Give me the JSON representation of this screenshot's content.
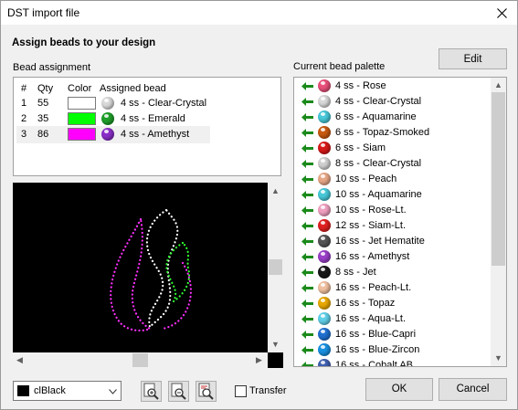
{
  "window": {
    "title": "DST import file"
  },
  "heading": "Assign beads to your design",
  "assignment": {
    "label": "Bead assignment",
    "headers": {
      "num": "#",
      "qty": "Qty",
      "color": "Color",
      "bead": "Assigned bead"
    },
    "rows": [
      {
        "num": "1",
        "qty": "55",
        "swatch": "#ffffff",
        "bead_color": "#d9d9d9",
        "bead": "4 ss - Clear-Crystal"
      },
      {
        "num": "2",
        "qty": "35",
        "swatch": "#00ff00",
        "bead_color": "#1e9e2a",
        "bead": "4 ss - Emerald"
      },
      {
        "num": "3",
        "qty": "86",
        "swatch": "#ff00ff",
        "bead_color": "#8b2fc9",
        "bead": "4 ss - Amethyst"
      }
    ]
  },
  "palette": {
    "label": "Current bead palette",
    "edit_label": "Edit",
    "items": [
      {
        "name": "4 ss - Rose",
        "color": "#e8517a"
      },
      {
        "name": "4 ss - Clear-Crystal",
        "color": "#d8d8d8"
      },
      {
        "name": "6 ss - Aquamarine",
        "color": "#48c8d8"
      },
      {
        "name": "6 ss - Topaz-Smoked",
        "color": "#c85a10"
      },
      {
        "name": "6 ss - Siam",
        "color": "#d81818"
      },
      {
        "name": "8 ss - Clear-Crystal",
        "color": "#d0d0d0"
      },
      {
        "name": "10 ss - Peach",
        "color": "#e8a888"
      },
      {
        "name": "10 ss - Aquamarine",
        "color": "#48c8d8"
      },
      {
        "name": "10 ss - Rose-Lt.",
        "color": "#f0a0c0"
      },
      {
        "name": "12 ss - Siam-Lt.",
        "color": "#e02020"
      },
      {
        "name": "16 ss - Jet Hematite",
        "color": "#555555"
      },
      {
        "name": "16 ss - Amethyst",
        "color": "#9a40c8"
      },
      {
        "name": "8 ss - Jet",
        "color": "#181818"
      },
      {
        "name": "16 ss - Peach-Lt.",
        "color": "#f0c0a0"
      },
      {
        "name": "16 ss - Topaz",
        "color": "#e8a800"
      },
      {
        "name": "16 ss - Aqua-Lt.",
        "color": "#60d0e8"
      },
      {
        "name": "16 ss - Blue-Capri",
        "color": "#2070d0"
      },
      {
        "name": "16 ss - Blue-Zircon",
        "color": "#1890e0"
      },
      {
        "name": "16 ss - Cobalt AB",
        "color": "#4060b0"
      }
    ]
  },
  "background_select": {
    "value": "clBlack",
    "swatch": "#000000"
  },
  "transfer_label": "Transfer",
  "ok_label": "OK",
  "cancel_label": "Cancel"
}
